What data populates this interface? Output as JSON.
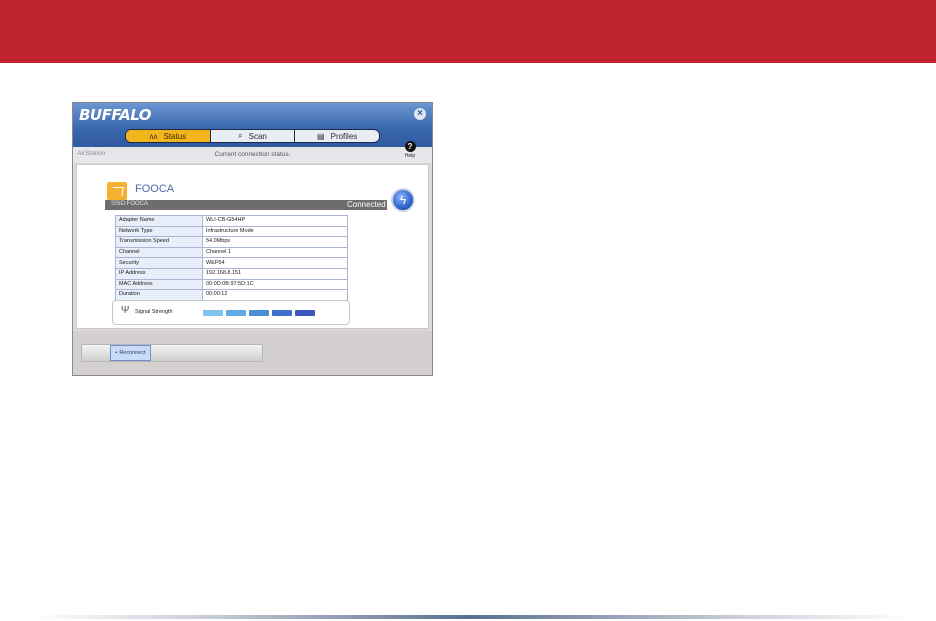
{
  "app": {
    "brand": "BUFFALO",
    "close_glyph": "×",
    "tabs": [
      {
        "label": "Status",
        "icon": "status-wave-icon",
        "glyph": "ᴧᴧ",
        "active": true
      },
      {
        "label": "Scan",
        "icon": "search-icon",
        "glyph": "⌕",
        "active": false
      },
      {
        "label": "Profiles",
        "icon": "profiles-icon",
        "glyph": "▤",
        "active": false
      }
    ],
    "product": "AirStation",
    "status_message": "Current connection status.",
    "help": {
      "glyph": "?",
      "label": "Help"
    }
  },
  "connection": {
    "network_name": "FOOCA",
    "ssid_label": "SSID:FOOCA",
    "state": "Connected"
  },
  "details": [
    {
      "label": "Adapter Name",
      "value": "WLI-CB-G54HP"
    },
    {
      "label": "Network Type",
      "value": "Infrastructure Mode"
    },
    {
      "label": "Transmission Speed",
      "value": "54.0Mbps"
    },
    {
      "label": "Channel",
      "value": "Channel 1"
    },
    {
      "label": "Security",
      "value": "WEP64"
    },
    {
      "label": "IP Address",
      "value": "192.168.8.151"
    },
    {
      "label": "MAC Address",
      "value": "00:0D:0B:97:5D:1C"
    },
    {
      "label": "Duration",
      "value": "00:00:12"
    }
  ],
  "signal": {
    "label": "Signal Strength",
    "level": 5,
    "max": 5,
    "bar_colors": [
      "#7fc4ef",
      "#5fa9e4",
      "#4a8ed8",
      "#3f6fcc",
      "#3a57bf"
    ]
  },
  "footer": {
    "reconnect_label": "Reconnect"
  }
}
